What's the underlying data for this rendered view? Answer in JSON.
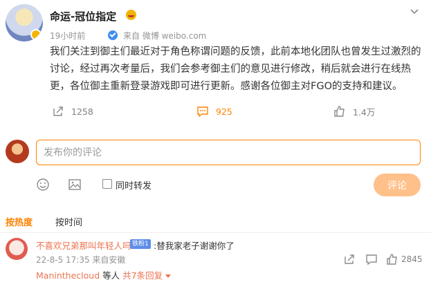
{
  "post": {
    "author": "命运-冠位指定",
    "time": "19小时前",
    "source": "来自 微博 weibo.com",
    "content": "我们关注到御主们最近对于角色称谓问题的反馈，此前本地化团队也曾发生过激烈的讨论，经过再次考量后，我们会参考御主们的意见进行修改，稍后就会进行在线热更，各位御主重新登录游戏即可进行更新。感谢各位御主对FGO的支持和建议。",
    "repost_count": "1258",
    "comment_count": "925",
    "like_count": "1.4万",
    "accent_color": "#ff8200"
  },
  "compose": {
    "placeholder": "发布你的评论",
    "repost_label": "同时转发",
    "submit_label": "评论"
  },
  "sort": {
    "hot": "按热度",
    "time": "按时间"
  },
  "comment": {
    "user": "不喜欢兄弟那叫年轻人吗",
    "fan_badge": "铁粉1",
    "text": ":替我家老子谢谢你了",
    "meta": "22-8-5 17:35 来自安徽",
    "like_count": "2845",
    "reply_user": "Maninthecloud",
    "reply_mid": "等人",
    "reply_total": "共7条回复"
  }
}
